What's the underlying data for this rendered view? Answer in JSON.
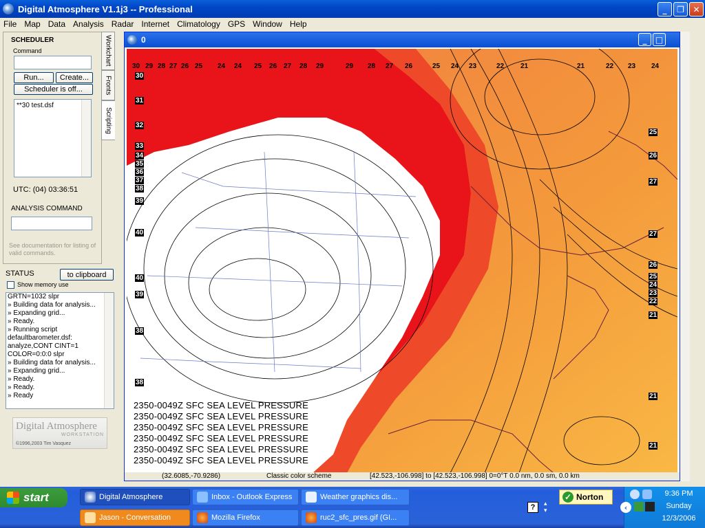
{
  "window": {
    "title": "Digital Atmosphere V1.1j3 -- Professional"
  },
  "menu": [
    "File",
    "Map",
    "Data",
    "Analysis",
    "Radar",
    "Internet",
    "Climatology",
    "GPS",
    "Window",
    "Help"
  ],
  "scheduler": {
    "header": "SCHEDULER",
    "command_label": "Command",
    "run_button": "Run...",
    "create_button": "Create...",
    "scheduler_off_button": "Scheduler is off...",
    "list_items": [
      "**30 test.dsf"
    ],
    "utc": "UTC: (04) 03:36:51"
  },
  "tabs": [
    "Workchart",
    "Fronts",
    "Scripting"
  ],
  "analysis": {
    "header": "ANALYSIS COMMAND",
    "hint": "See documentation for listing of valid commands."
  },
  "status": {
    "header": "STATUS",
    "clipboard_button": "to clipboard",
    "show_memory_label": "Show memory use",
    "log": [
      "GRTN=1032 slpr",
      "» Building data for analysis...",
      "» Expanding grid...",
      "» Ready.",
      "» Running script",
      "defaultbarometer.dsf:",
      "analyze,CONT CINT=1",
      "COLOR=0:0:0 slpr",
      "» Building data for analysis...",
      "» Expanding grid...",
      "» Ready.",
      "» Ready.",
      "» Ready"
    ]
  },
  "logo": {
    "name": "Digital Atmosphere",
    "sub": "WORKSTATION",
    "copyright": "©1996,2003 Tim Vasquez"
  },
  "map_window": {
    "title": "0",
    "top_labels": [
      "30",
      "29",
      "28",
      "27",
      "26",
      "25",
      "24",
      "24",
      "25",
      "26",
      "27",
      "28",
      "29",
      "29",
      "28",
      "27",
      "26",
      "25",
      "24",
      "23",
      "22",
      "21",
      "21",
      "22",
      "23",
      "24"
    ],
    "left_labels": [
      "30",
      "31",
      "32",
      "33",
      "34",
      "35",
      "36",
      "37",
      "38",
      "39",
      "40",
      "40",
      "39",
      "38",
      "38"
    ],
    "right_labels": [
      "25",
      "26",
      "27",
      "27",
      "26",
      "25",
      "24",
      "23",
      "22",
      "21",
      "21",
      "21"
    ],
    "map_title_lines": [
      "2350-0049Z SFC SEA LEVEL PRESSURE",
      "2350-0049Z SFC SEA LEVEL PRESSURE",
      "2350-0049Z SFC SEA LEVEL PRESSURE",
      "2350-0049Z SFC SEA LEVEL PRESSURE",
      "2350-0049Z SFC SEA LEVEL PRESSURE",
      "2350-0049Z SFC SEA LEVEL PRESSURE"
    ],
    "status_coords": "(32.6085,-70.9286)",
    "status_scheme": "Classic color scheme",
    "status_info": "[42.523,-106.998] to [42.523,-106.998] 0=0°T 0.0 nm, 0.0 sm, 0.0 km"
  },
  "taskbar": {
    "start": "start",
    "tasks_top": [
      "Digital Atmosphere",
      "Inbox - Outlook Express",
      "Weather graphics dis..."
    ],
    "tasks_bottom": [
      "Jason - Conversation",
      "Mozilla Firefox",
      "ruc2_sfc_pres.gif (GI..."
    ],
    "norton": "Norton",
    "time": "9:36 PM",
    "day": "Sunday",
    "date": "12/3/2006"
  },
  "colors": {
    "xp_blue": "#0a5fd8",
    "map_red": "#e8141a",
    "map_orange": "#f7a13a",
    "start_green": "#3c9c3c"
  }
}
